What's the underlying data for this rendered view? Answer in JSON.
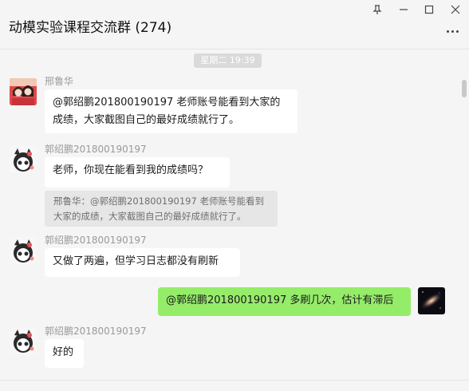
{
  "header": {
    "title": "动模实验课程交流群 (274)",
    "icons": [
      "pin-icon",
      "minimize-icon",
      "maximize-icon",
      "close-icon",
      "more-icon"
    ]
  },
  "chat": {
    "timestamp": "星期二 19:39",
    "messages": [
      {
        "sender": "邢鲁华",
        "text_lines": [
          "@郭绍鹏201800190197 老师账号能看到大家的",
          "成绩，大家截图自己的最好成绩就行了。"
        ]
      },
      {
        "sender": "郭绍鹏201800190197",
        "text": "老师，你现在能看到我的成绩吗？",
        "quote_lines": [
          "邢鲁华：@郭绍鹏201800190197 老师账号能看到",
          "大家的成绩，大家截图自己的最好成绩就行了。"
        ]
      },
      {
        "sender": "郭绍鹏201800190197",
        "text": "又做了两遍，但学习日志都没有刷新"
      },
      {
        "self": true,
        "text": "@郭绍鹏201800190197 多刷几次，估计有滞后"
      },
      {
        "sender": "郭绍鹏201800190197",
        "text": "好的"
      }
    ]
  },
  "colors": {
    "self_bubble": "#95ec69",
    "other_bubble": "#ffffff",
    "background": "#f5f5f5"
  }
}
